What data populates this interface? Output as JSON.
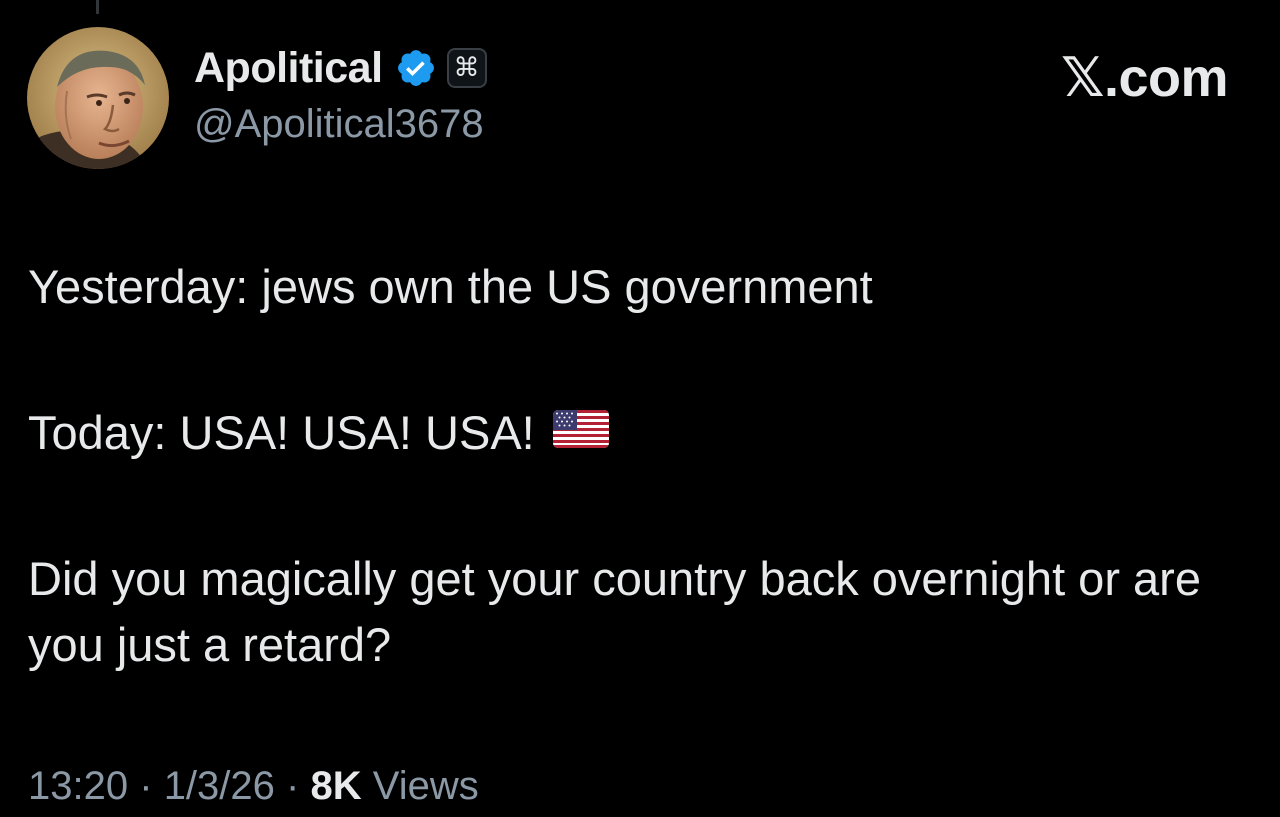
{
  "author": {
    "display_name": "Apolitical",
    "handle": "@Apolitical3678",
    "verified": true,
    "affiliate_badge_icon": "command-key-icon",
    "avatar_icon": "portrait-avatar"
  },
  "site_mark": "𝕏.com",
  "tweet": {
    "lines": [
      "Yesterday: jews own the US government",
      "Today: USA! USA! USA!",
      "Did you magically get your country back overnight or are you just a retard?"
    ],
    "flag_icon": "us-flag-emoji"
  },
  "meta": {
    "time": "13:20",
    "date": "1/3/26",
    "separator": "·",
    "views_count": "8K",
    "views_label": "Views"
  },
  "colors": {
    "background": "#000000",
    "text_primary": "#e7e9ea",
    "text_secondary": "#8b98a5",
    "verified_blue": "#1d9bf0"
  }
}
